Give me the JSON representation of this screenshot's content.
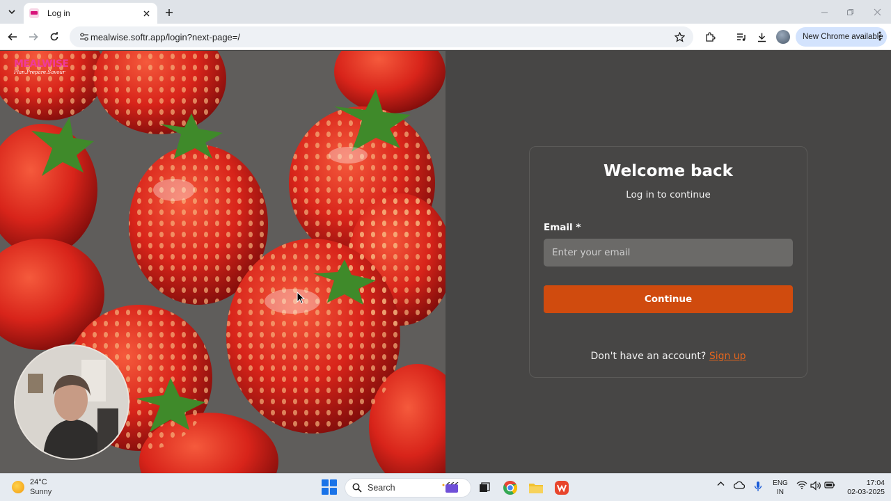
{
  "browser": {
    "tab_title": "Log in",
    "url": "mealwise.softr.app/login?next-page=/",
    "update_badge": "New Chrome available"
  },
  "brand": {
    "name": "MEALWISE",
    "tagline": "Plan.Prepare.Savour",
    "accent_color": "#f03a9a"
  },
  "login": {
    "title": "Welcome back",
    "subtitle": "Log in to continue",
    "email_label": "Email *",
    "email_placeholder": "Enter your email",
    "email_value": "",
    "continue_label": "Continue",
    "no_account_text": "Don't have an account?",
    "signup_label": "Sign up",
    "button_color": "#d04b0e"
  },
  "taskbar": {
    "weather_temp": "24°C",
    "weather_desc": "Sunny",
    "search_label": "Search",
    "lang_line1": "ENG",
    "lang_line2": "IN",
    "time": "17:04",
    "date": "02-03-2025"
  }
}
